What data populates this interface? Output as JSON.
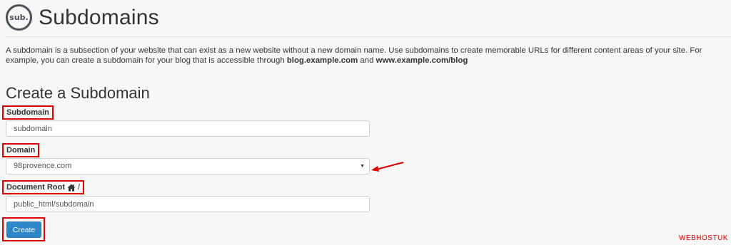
{
  "header": {
    "icon_text": "sub.",
    "title": "Subdomains"
  },
  "description": {
    "text_1": "A subdomain is a subsection of your website that can exist as a new website without a new domain name. Use subdomains to create memorable URLs for different content areas of your site. For example, you can create a subdomain for your blog that is accessible through ",
    "example_1": "blog.example.com",
    "text_2": " and ",
    "example_2": "www.example.com/blog"
  },
  "form": {
    "section_title": "Create a Subdomain",
    "subdomain_label": "Subdomain",
    "subdomain_value": "subdomain",
    "domain_label": "Domain",
    "domain_value": "98provence.com",
    "docroot_label": "Document Root",
    "docroot_suffix": "/",
    "docroot_value": "public_html/subdomain",
    "create_label": "Create"
  },
  "watermark": "WEBHOSTUK",
  "colors": {
    "highlight": "#e00000",
    "button": "#2d87c8",
    "icon": "#4a4f58"
  },
  "icons": [
    "sub-icon",
    "home-icon",
    "caret-down-icon",
    "arrow-icon"
  ]
}
